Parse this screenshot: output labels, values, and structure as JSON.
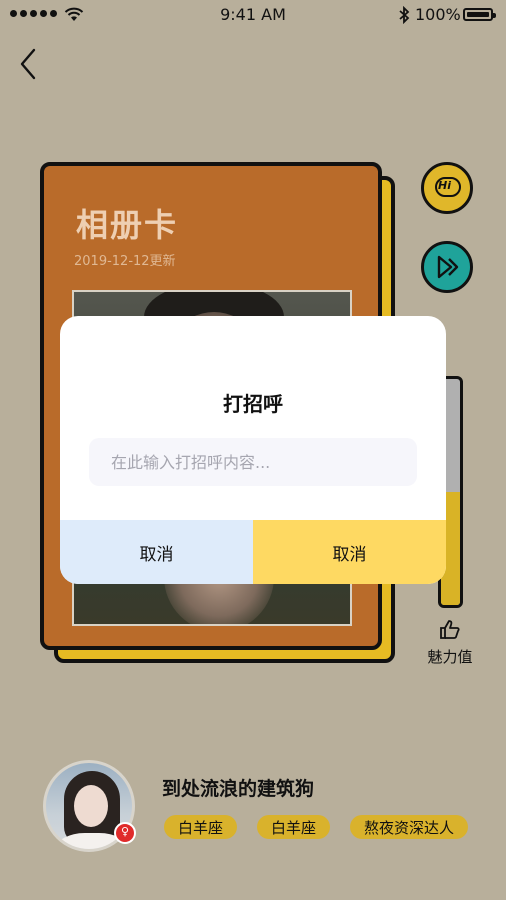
{
  "status_bar": {
    "time": "9:41 AM",
    "battery_percent": "100%",
    "bluetooth_icon": "bluetooth-icon",
    "wifi_icon": "wifi-icon"
  },
  "nav": {
    "back_icon": "chevron-left-icon"
  },
  "album_card": {
    "title": "相册卡",
    "date": "2019-12-12更新"
  },
  "side_actions": {
    "hi_label": "Hi",
    "play_icon": "play-forward-icon",
    "thumb_icon": "thumbs-up-icon",
    "charm_label": "魅力值",
    "charm_fill_fraction": 0.5
  },
  "dialog": {
    "title": "打招呼",
    "input_placeholder": "在此输入打招呼内容...",
    "input_value": "",
    "cancel_left": "取消",
    "cancel_right": "取消"
  },
  "profile": {
    "username": "到处流浪的建筑狗",
    "badge_symbol": "♀",
    "tags": [
      "白羊座",
      "白羊座",
      "熬夜资深达人"
    ]
  },
  "colors": {
    "background": "#b8af9b",
    "card": "#b96b2a",
    "card_back": "#e6bb23",
    "hi_button": "#e0b72a",
    "play_button": "#1fa39a",
    "dialog_left_button": "#deebfa",
    "dialog_right_button": "#fed962",
    "tag": "#d9b22c"
  }
}
